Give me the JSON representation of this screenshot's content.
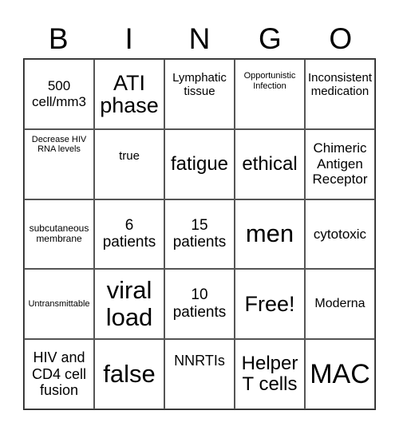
{
  "header": {
    "letters": [
      "B",
      "I",
      "N",
      "G",
      "O"
    ]
  },
  "board": {
    "rows": [
      [
        "500 cell/mm3",
        "ATI phase",
        "Lymphatic tissue",
        "Opportunistic Infection",
        "Inconsistent medication"
      ],
      [
        "Decrease HIV RNA levels",
        "true",
        "fatigue",
        "ethical",
        "Chimeric Antigen Receptor"
      ],
      [
        "subcutaneous membrane",
        "6 patients",
        "15 patients",
        "men",
        "cytotoxic"
      ],
      [
        "Untransmittable",
        "viral load",
        "10 patients",
        "Free!",
        "Moderna"
      ],
      [
        "HIV and CD4 cell fusion",
        "false",
        "NNRTIs",
        "Helper T cells",
        "MAC"
      ]
    ]
  }
}
